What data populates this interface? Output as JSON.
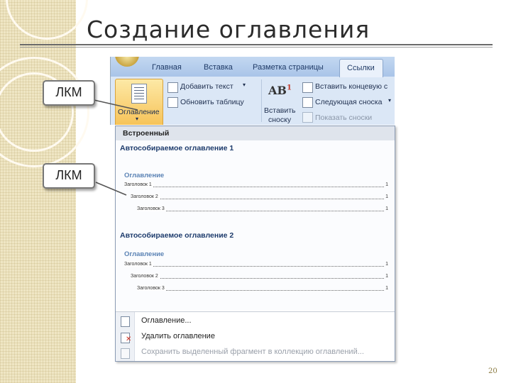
{
  "slide": {
    "title": "Создание оглавления",
    "page_number": "20"
  },
  "callouts": {
    "first": "ЛКМ",
    "second": "ЛКМ"
  },
  "ribbon": {
    "tabs": [
      "Главная",
      "Вставка",
      "Разметка страницы"
    ],
    "active_tab": "Ссылки",
    "toc_button_label": "Оглавление",
    "add_text": "Добавить текст",
    "update_table": "Обновить таблицу",
    "insert_footnote_line1": "Вставить",
    "insert_footnote_line2": "сноску",
    "insert_endnote": "Вставить концевую с",
    "next_footnote": "Следующая сноска",
    "show_notes": "Показать сноски"
  },
  "dropdown": {
    "header": "Встроенный",
    "sections": [
      {
        "name": "Автособираемое оглавление 1",
        "toc_title": "Оглавление",
        "entries": [
          {
            "text": "Заголовок 1",
            "page": "1"
          },
          {
            "text": "Заголовок 2",
            "page": "1"
          },
          {
            "text": "Заголовок 3",
            "page": "1"
          }
        ]
      },
      {
        "name": "Автособираемое оглавление 2",
        "toc_title": "Оглавление",
        "entries": [
          {
            "text": "Заголовок 1",
            "page": "1"
          },
          {
            "text": "Заголовок 2",
            "page": "1"
          },
          {
            "text": "Заголовок 3",
            "page": "1"
          }
        ]
      }
    ],
    "menu": {
      "toc_dialog": "Оглавление...",
      "remove_toc": "Удалить оглавление",
      "save_selection": "Сохранить выделенный фрагмент в коллекцию оглавлений..."
    }
  },
  "colors": {
    "ribbon_bg": "#dbe7f6",
    "toc_title": "#5b83b5",
    "section_head": "#1d3b6c"
  },
  "icons": [
    "office-button-icon",
    "toc-document-icon",
    "add-text-icon",
    "update-table-icon",
    "footnote-ab-icon",
    "endnote-icon",
    "next-footnote-icon",
    "show-notes-icon",
    "toc-dialog-icon",
    "remove-toc-icon",
    "save-toc-icon"
  ]
}
